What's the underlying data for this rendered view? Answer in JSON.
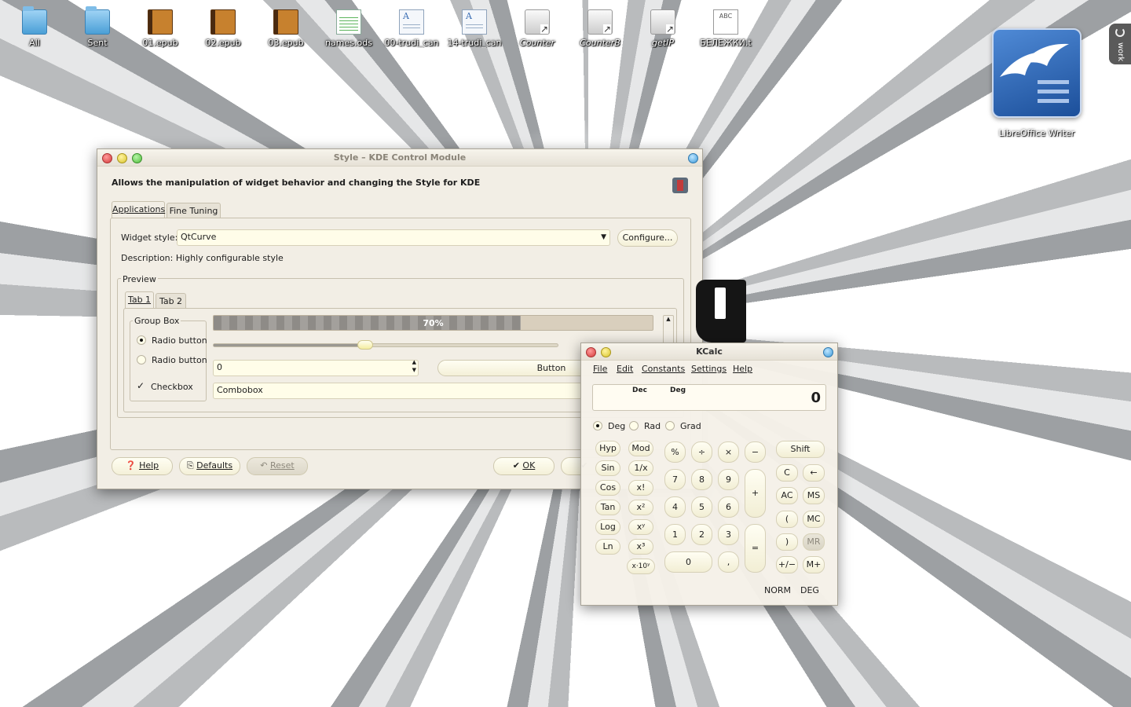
{
  "desktop": {
    "icons": [
      {
        "label": "All",
        "type": "folder"
      },
      {
        "label": "Sent",
        "type": "folder"
      },
      {
        "label": "01.epub",
        "type": "book"
      },
      {
        "label": "02.epub",
        "type": "book"
      },
      {
        "label": "03.epub",
        "type": "book"
      },
      {
        "label": "names.ods",
        "type": "sheet"
      },
      {
        "label": "00-trudi_can",
        "type": "doc"
      },
      {
        "label": "14-trudi_can",
        "type": "doc"
      },
      {
        "label": "Counter",
        "type": "link"
      },
      {
        "label": "CounterB",
        "type": "link"
      },
      {
        "label": "getIP",
        "type": "link"
      },
      {
        "label": "БЕЛЕЖКИ.t",
        "type": "abc",
        "glyph_text": "ABC"
      }
    ],
    "libreoffice_label": "LibreOffice Writer",
    "activity_label": "work"
  },
  "kcm": {
    "title": "Style – KDE Control Module",
    "header": "Allows the manipulation of widget behavior and changing the Style for KDE",
    "tabs": [
      "Applications",
      "Fine Tuning"
    ],
    "widget_style_label": "Widget style:",
    "widget_style_value": "QtCurve",
    "configure_label": "Configure...",
    "description": "Description: Highly configurable style",
    "preview_label": "Preview",
    "preview_tabs": [
      "Tab 1",
      "Tab 2"
    ],
    "group_box_label": "Group Box",
    "radio1": "Radio button",
    "radio2": "Radio button",
    "checkbox": "Checkbox",
    "progress_text": "70%",
    "progress_value": 70,
    "slider_value": 0.44,
    "spin_value": "0",
    "button_label": "Button",
    "combobox_value": "Combobox",
    "help_label": "Help",
    "defaults_label": "Defaults",
    "reset_label": "Reset",
    "ok_label": "OK"
  },
  "kcalc": {
    "title": "KCalc",
    "menu": [
      "File",
      "Edit",
      "Constants",
      "Settings",
      "Help"
    ],
    "display_base": "Dec",
    "display_angle": "Deg",
    "display_value": "0",
    "angle_modes": [
      "Deg",
      "Rad",
      "Grad"
    ],
    "func_buttons": [
      [
        "Hyp",
        "Mod"
      ],
      [
        "Sin",
        "1/x"
      ],
      [
        "Cos",
        "x!"
      ],
      [
        "Tan",
        "x²"
      ],
      [
        "Log",
        "xʸ"
      ],
      [
        "Ln",
        "x³"
      ],
      [
        "",
        "x·10ʸ"
      ]
    ],
    "ops_top": [
      "%",
      "÷",
      "×",
      "−"
    ],
    "digits": [
      "7",
      "8",
      "9",
      "4",
      "5",
      "6",
      "1",
      "2",
      "3"
    ],
    "zero": "0",
    "comma": ",",
    "plus": "+",
    "equals": "=",
    "shift": "Shift",
    "right_buttons": [
      [
        "C",
        "←"
      ],
      [
        "AC",
        "MS"
      ],
      [
        "(",
        "MC"
      ],
      [
        ")",
        "MR"
      ],
      [
        "+/−",
        "M+"
      ]
    ],
    "status": [
      "NORM",
      "DEG"
    ]
  }
}
